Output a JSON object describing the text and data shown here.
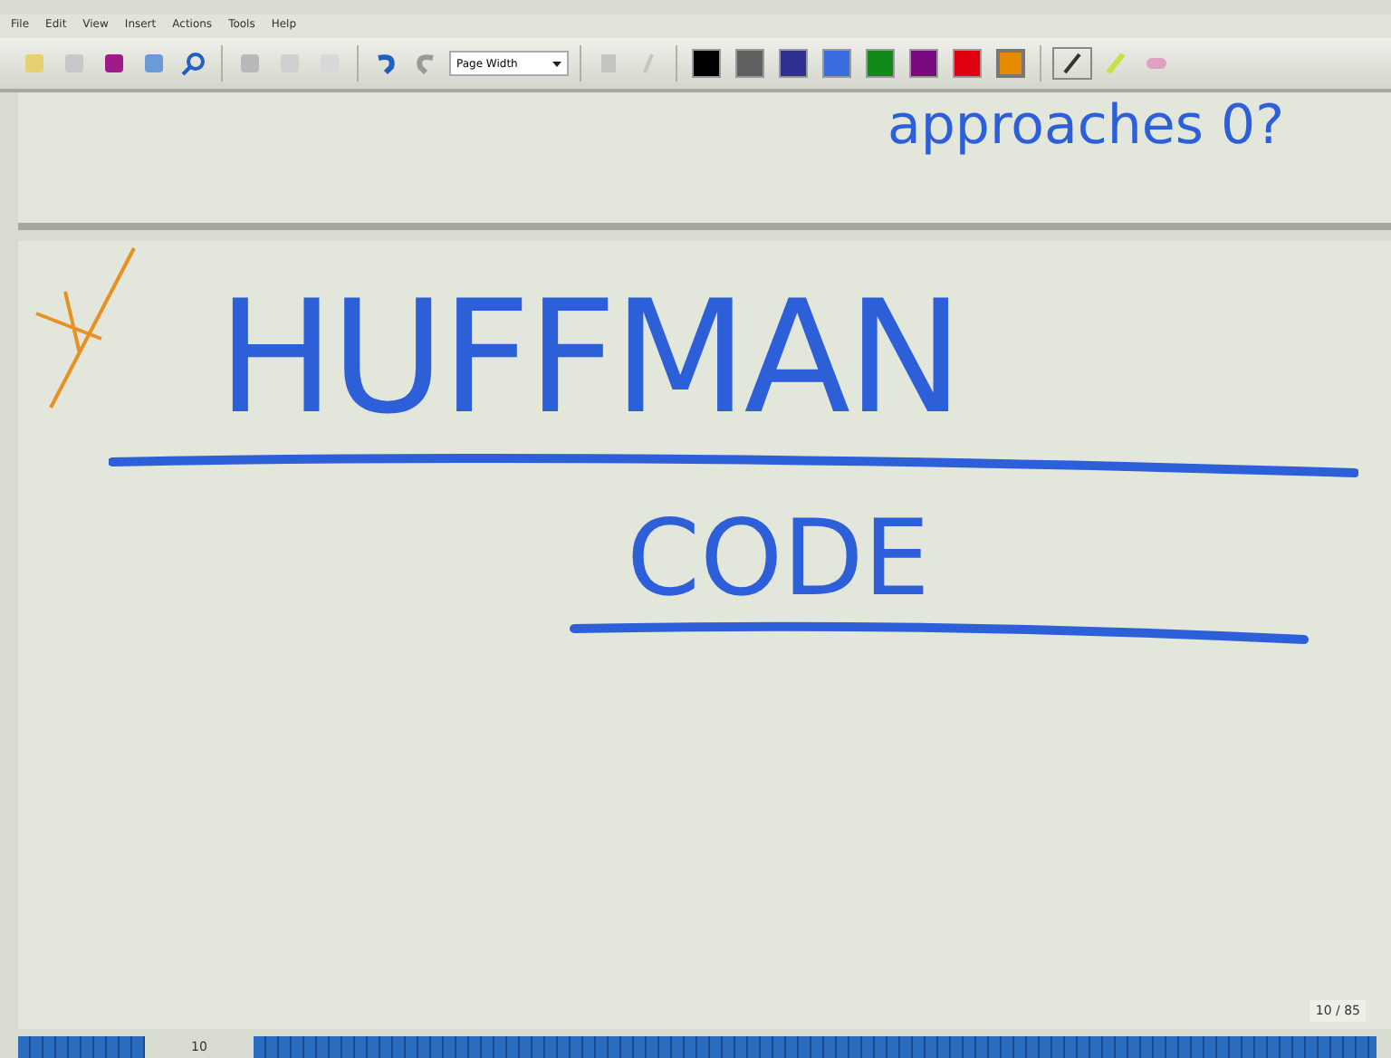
{
  "menu": [
    "File",
    "Edit",
    "View",
    "Insert",
    "Actions",
    "Tools",
    "Help"
  ],
  "zoom": {
    "value": "Page Width"
  },
  "pen_colors": [
    {
      "color": "#000000",
      "selected": false
    },
    {
      "color": "#606060",
      "selected": false
    },
    {
      "color": "#303090",
      "selected": false
    },
    {
      "color": "#3a6ee0",
      "selected": false
    },
    {
      "color": "#128a1a",
      "selected": false
    },
    {
      "color": "#7a0a80",
      "selected": false
    },
    {
      "color": "#e00010",
      "selected": false
    },
    {
      "color": "#e88a00",
      "selected": true
    }
  ],
  "previous_page": {
    "ink": "approaches 0?"
  },
  "page": {
    "title": "HUFFMAN",
    "subtitle": "CODE"
  },
  "page_counter": "10 / 85",
  "page_bar": {
    "current": "10"
  }
}
